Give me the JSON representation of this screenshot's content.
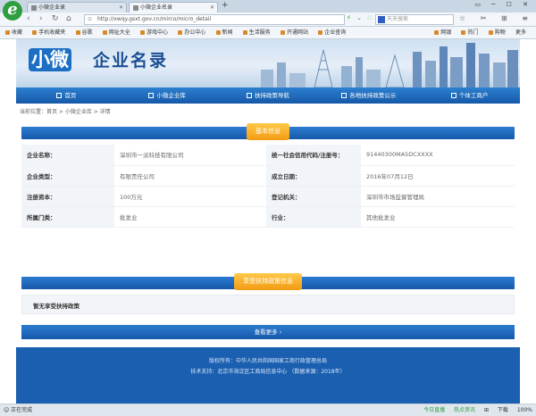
{
  "browser": {
    "tabs": [
      {
        "label": "小微企业录"
      },
      {
        "label": "小微企业名录"
      }
    ],
    "new_tab": "+",
    "window_controls": "▭ ─ ☐ ✕",
    "address": "http://xwqy.gsxt.gov.cn/mirco/micro_detail",
    "address_right": "⚡ ⌄ ∷",
    "search_placeholder": "天天搜索",
    "toolbar_right": "☆ ✂ ⊞ ≡",
    "bookmarks": [
      "收藏",
      "手机收藏夹",
      "谷歌",
      "网址大全",
      "游戏中心",
      "办公中心",
      "新闻",
      "生活服务",
      "开通网站",
      "企业查询"
    ],
    "bookmarks_right": [
      "网银",
      "热门",
      "购物",
      "更多"
    ],
    "status_left": "☺ 正在完成",
    "status_right": [
      "今日直播",
      "热点资讯",
      "⊞",
      "下载",
      "100%"
    ]
  },
  "site": {
    "logo_short": "小微",
    "logo_name": "企业名录",
    "nav": [
      {
        "icon": "home-icon",
        "label": "首页"
      },
      {
        "icon": "list-icon",
        "label": "小微企业库"
      },
      {
        "icon": "policy-icon",
        "label": "扶持政策导航"
      },
      {
        "icon": "news-icon",
        "label": "各地扶持政策公示"
      },
      {
        "icon": "user-icon",
        "label": "个体工商户"
      }
    ],
    "breadcrumb": "当前位置：首页 > 小微企业库 > 详情"
  },
  "basic_info": {
    "title": "基本信息",
    "rows": [
      {
        "l1": "企业名称：",
        "v1": "深圳市一派科技有限公司",
        "l2": "统一社会信用代码/注册号：",
        "v2": "91440300MA5DCXXXX"
      },
      {
        "l1": "企业类型：",
        "v1": "有限责任公司",
        "l2": "成立日期：",
        "v2": "2016年07月12日"
      },
      {
        "l1": "注册资本：",
        "v1": "100万元",
        "l2": "登记机关：",
        "v2": "深圳市市场监督管理局"
      },
      {
        "l1": "所属门类：",
        "v1": "批发业",
        "l2": "行业：",
        "v2": "其他批发业"
      }
    ]
  },
  "support": {
    "title": "享受扶持政策信息",
    "empty_text": "暂无享受扶持政策"
  },
  "more_button": "查看更多 ›",
  "footer": {
    "line1": "版权所有：中华人民共和国国家工商行政管理总局",
    "line2": "技术支持：北京市海淀区工商局信息中心 （数据来源：2018年）"
  },
  "colors": {
    "nav_blue": "#1d6fc4",
    "accent_orange": "#f39b12",
    "footer_blue": "#1a5fb0"
  }
}
